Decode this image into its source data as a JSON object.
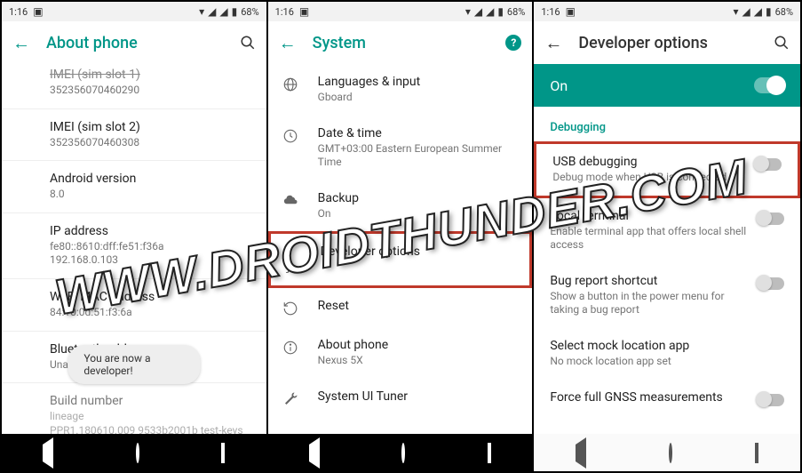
{
  "status": {
    "time": "1:16",
    "battery": "68%"
  },
  "watermark": "WWW.DROIDTHUNDER.COM",
  "screen1": {
    "title": "About phone",
    "toast": "You are now a developer!",
    "items": [
      {
        "title": "IMEI (sim slot 1)",
        "sub": "352356070460290"
      },
      {
        "title": "IMEI (sim slot 2)",
        "sub": "352356070460308"
      },
      {
        "title": "Android version",
        "sub": "8.0"
      },
      {
        "title": "IP address",
        "sub": "fe80::8610:dff:fe51:f36a\n192.168.0.103"
      },
      {
        "title": "Wi-Fi MAC address",
        "sub": "84:10:0d:51:f3:6a"
      },
      {
        "title": "Bluetooth address",
        "sub": "Unavailable"
      },
      {
        "title": "Build number",
        "sub": "lineage\nPPR1.180610.009 9533b2001b test-keys"
      }
    ]
  },
  "screen2": {
    "title": "System",
    "items": [
      {
        "title": "Languages & input",
        "sub": "Gboard"
      },
      {
        "title": "Date & time",
        "sub": "GMT+03:00 Eastern European Summer Time"
      },
      {
        "title": "Backup",
        "sub": "On"
      },
      {
        "title": "Developer options",
        "sub": ""
      },
      {
        "title": "Reset",
        "sub": ""
      },
      {
        "title": "About phone",
        "sub": "Nexus 5X"
      },
      {
        "title": "System UI Tuner",
        "sub": ""
      }
    ]
  },
  "screen3": {
    "title": "Developer options",
    "on_label": "On",
    "section": "Debugging",
    "items": [
      {
        "title": "USB debugging",
        "sub": "Debug mode when USB is connected"
      },
      {
        "title": "Local terminal",
        "sub": "Enable terminal app that offers local shell access"
      },
      {
        "title": "Bug report shortcut",
        "sub": "Show a button in the power menu for taking a bug report"
      },
      {
        "title": "Select mock location app",
        "sub": "No mock location app set"
      },
      {
        "title": "Force full GNSS measurements",
        "sub": ""
      }
    ]
  }
}
